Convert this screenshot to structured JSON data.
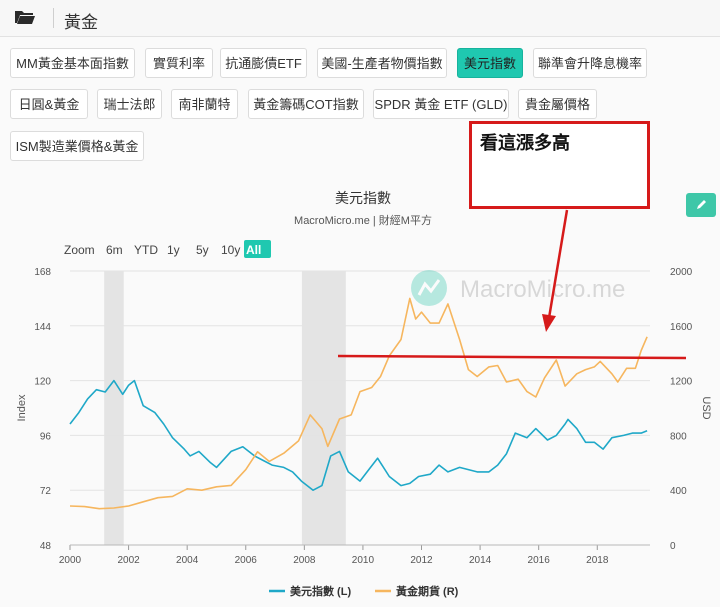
{
  "header": {
    "title": "黃金"
  },
  "tabs": [
    "MM黃金基本面指數",
    "實質利率",
    "抗通膨債ETF",
    "美國-生產者物價指數",
    "美元指數",
    "聯準會升降息機率",
    "日圓&黃金",
    "瑞士法郎",
    "南非蘭特",
    "黃金籌碼COT指數",
    "SPDR 黃金 ETF (GLD)",
    "貴金屬價格",
    "ISM製造業價格&黃金"
  ],
  "active_tab": "美元指數",
  "annotation": {
    "text": "看這漲多高"
  },
  "zoom": {
    "label": "Zoom",
    "buttons": [
      "6m",
      "YTD",
      "1y",
      "5y",
      "10y",
      "All"
    ],
    "active": "All"
  },
  "watermark": "MacroMicro.me",
  "colors": {
    "dxy": "#1fa8c8",
    "gold": "#f6b65e",
    "shade": "#e4e4e4",
    "annotation": "#d61a1a"
  },
  "chart_data": {
    "type": "line",
    "title": "美元指數",
    "subtitle": "MacroMicro.me | 財經M平方",
    "x": {
      "ticks": [
        "2000",
        "2002",
        "2004",
        "2006",
        "2008",
        "2010",
        "2012",
        "2014",
        "2016",
        "2018"
      ],
      "range": [
        "2000-01",
        "2019-09"
      ]
    },
    "y_left": {
      "label": "Index",
      "ticks": [
        48,
        72,
        96,
        120,
        144,
        168
      ],
      "range": [
        48,
        168
      ]
    },
    "y_right": {
      "label": "USD",
      "ticks": [
        0,
        400,
        800,
        1200,
        1600,
        2000
      ],
      "range": [
        0,
        2000
      ]
    },
    "recession_shading": [
      [
        "2001-03",
        "2001-11"
      ],
      [
        "2007-12",
        "2009-06"
      ]
    ],
    "grid": true,
    "legend_position": "bottom",
    "series": [
      {
        "name": "美元指數 (L)",
        "axis": "left",
        "points": [
          [
            2000.0,
            101
          ],
          [
            2000.3,
            106
          ],
          [
            2000.6,
            112
          ],
          [
            2000.9,
            116
          ],
          [
            2001.2,
            115
          ],
          [
            2001.5,
            120
          ],
          [
            2001.8,
            114
          ],
          [
            2002.0,
            118
          ],
          [
            2002.2,
            120
          ],
          [
            2002.5,
            109
          ],
          [
            2002.9,
            106
          ],
          [
            2003.2,
            101
          ],
          [
            2003.5,
            95
          ],
          [
            2003.9,
            90
          ],
          [
            2004.1,
            87
          ],
          [
            2004.4,
            89
          ],
          [
            2004.8,
            84
          ],
          [
            2005.0,
            82
          ],
          [
            2005.5,
            89
          ],
          [
            2005.9,
            91
          ],
          [
            2006.3,
            87
          ],
          [
            2006.6,
            85
          ],
          [
            2006.9,
            83
          ],
          [
            2007.3,
            82
          ],
          [
            2007.6,
            80
          ],
          [
            2007.9,
            76
          ],
          [
            2008.3,
            72
          ],
          [
            2008.6,
            74
          ],
          [
            2008.9,
            87
          ],
          [
            2009.2,
            89
          ],
          [
            2009.5,
            80
          ],
          [
            2009.9,
            76
          ],
          [
            2010.2,
            81
          ],
          [
            2010.5,
            86
          ],
          [
            2010.9,
            78
          ],
          [
            2011.3,
            74
          ],
          [
            2011.6,
            75
          ],
          [
            2011.9,
            78
          ],
          [
            2012.3,
            79
          ],
          [
            2012.6,
            83
          ],
          [
            2012.9,
            80
          ],
          [
            2013.3,
            82
          ],
          [
            2013.6,
            81
          ],
          [
            2013.9,
            80
          ],
          [
            2014.3,
            80
          ],
          [
            2014.6,
            83
          ],
          [
            2014.9,
            88
          ],
          [
            2015.2,
            97
          ],
          [
            2015.6,
            95
          ],
          [
            2015.9,
            99
          ],
          [
            2016.3,
            94
          ],
          [
            2016.6,
            96
          ],
          [
            2016.9,
            101
          ],
          [
            2017.0,
            103
          ],
          [
            2017.3,
            99
          ],
          [
            2017.6,
            93
          ],
          [
            2017.9,
            93
          ],
          [
            2018.2,
            90
          ],
          [
            2018.5,
            95
          ],
          [
            2018.9,
            96
          ],
          [
            2019.2,
            97
          ],
          [
            2019.5,
            97
          ],
          [
            2019.7,
            98
          ]
        ]
      },
      {
        "name": "黃金期貨 (R)",
        "axis": "right",
        "points": [
          [
            2000.0,
            285
          ],
          [
            2000.5,
            280
          ],
          [
            2001.0,
            265
          ],
          [
            2001.5,
            270
          ],
          [
            2002.0,
            285
          ],
          [
            2002.5,
            315
          ],
          [
            2003.0,
            345
          ],
          [
            2003.5,
            355
          ],
          [
            2004.0,
            410
          ],
          [
            2004.5,
            400
          ],
          [
            2005.0,
            425
          ],
          [
            2005.5,
            435
          ],
          [
            2006.0,
            550
          ],
          [
            2006.4,
            680
          ],
          [
            2006.8,
            610
          ],
          [
            2007.3,
            670
          ],
          [
            2007.8,
            760
          ],
          [
            2008.2,
            950
          ],
          [
            2008.6,
            850
          ],
          [
            2008.8,
            720
          ],
          [
            2009.2,
            920
          ],
          [
            2009.6,
            950
          ],
          [
            2009.9,
            1120
          ],
          [
            2010.3,
            1150
          ],
          [
            2010.6,
            1230
          ],
          [
            2010.9,
            1380
          ],
          [
            2011.3,
            1500
          ],
          [
            2011.6,
            1800
          ],
          [
            2011.8,
            1650
          ],
          [
            2012.0,
            1700
          ],
          [
            2012.3,
            1620
          ],
          [
            2012.6,
            1620
          ],
          [
            2012.9,
            1760
          ],
          [
            2013.3,
            1500
          ],
          [
            2013.6,
            1280
          ],
          [
            2013.9,
            1230
          ],
          [
            2014.3,
            1300
          ],
          [
            2014.6,
            1310
          ],
          [
            2014.9,
            1190
          ],
          [
            2015.3,
            1210
          ],
          [
            2015.6,
            1120
          ],
          [
            2015.9,
            1080
          ],
          [
            2016.2,
            1220
          ],
          [
            2016.6,
            1350
          ],
          [
            2016.9,
            1160
          ],
          [
            2017.3,
            1250
          ],
          [
            2017.6,
            1280
          ],
          [
            2017.9,
            1300
          ],
          [
            2018.1,
            1340
          ],
          [
            2018.5,
            1250
          ],
          [
            2018.7,
            1190
          ],
          [
            2019.0,
            1290
          ],
          [
            2019.3,
            1290
          ],
          [
            2019.5,
            1420
          ],
          [
            2019.7,
            1520
          ]
        ]
      }
    ]
  }
}
